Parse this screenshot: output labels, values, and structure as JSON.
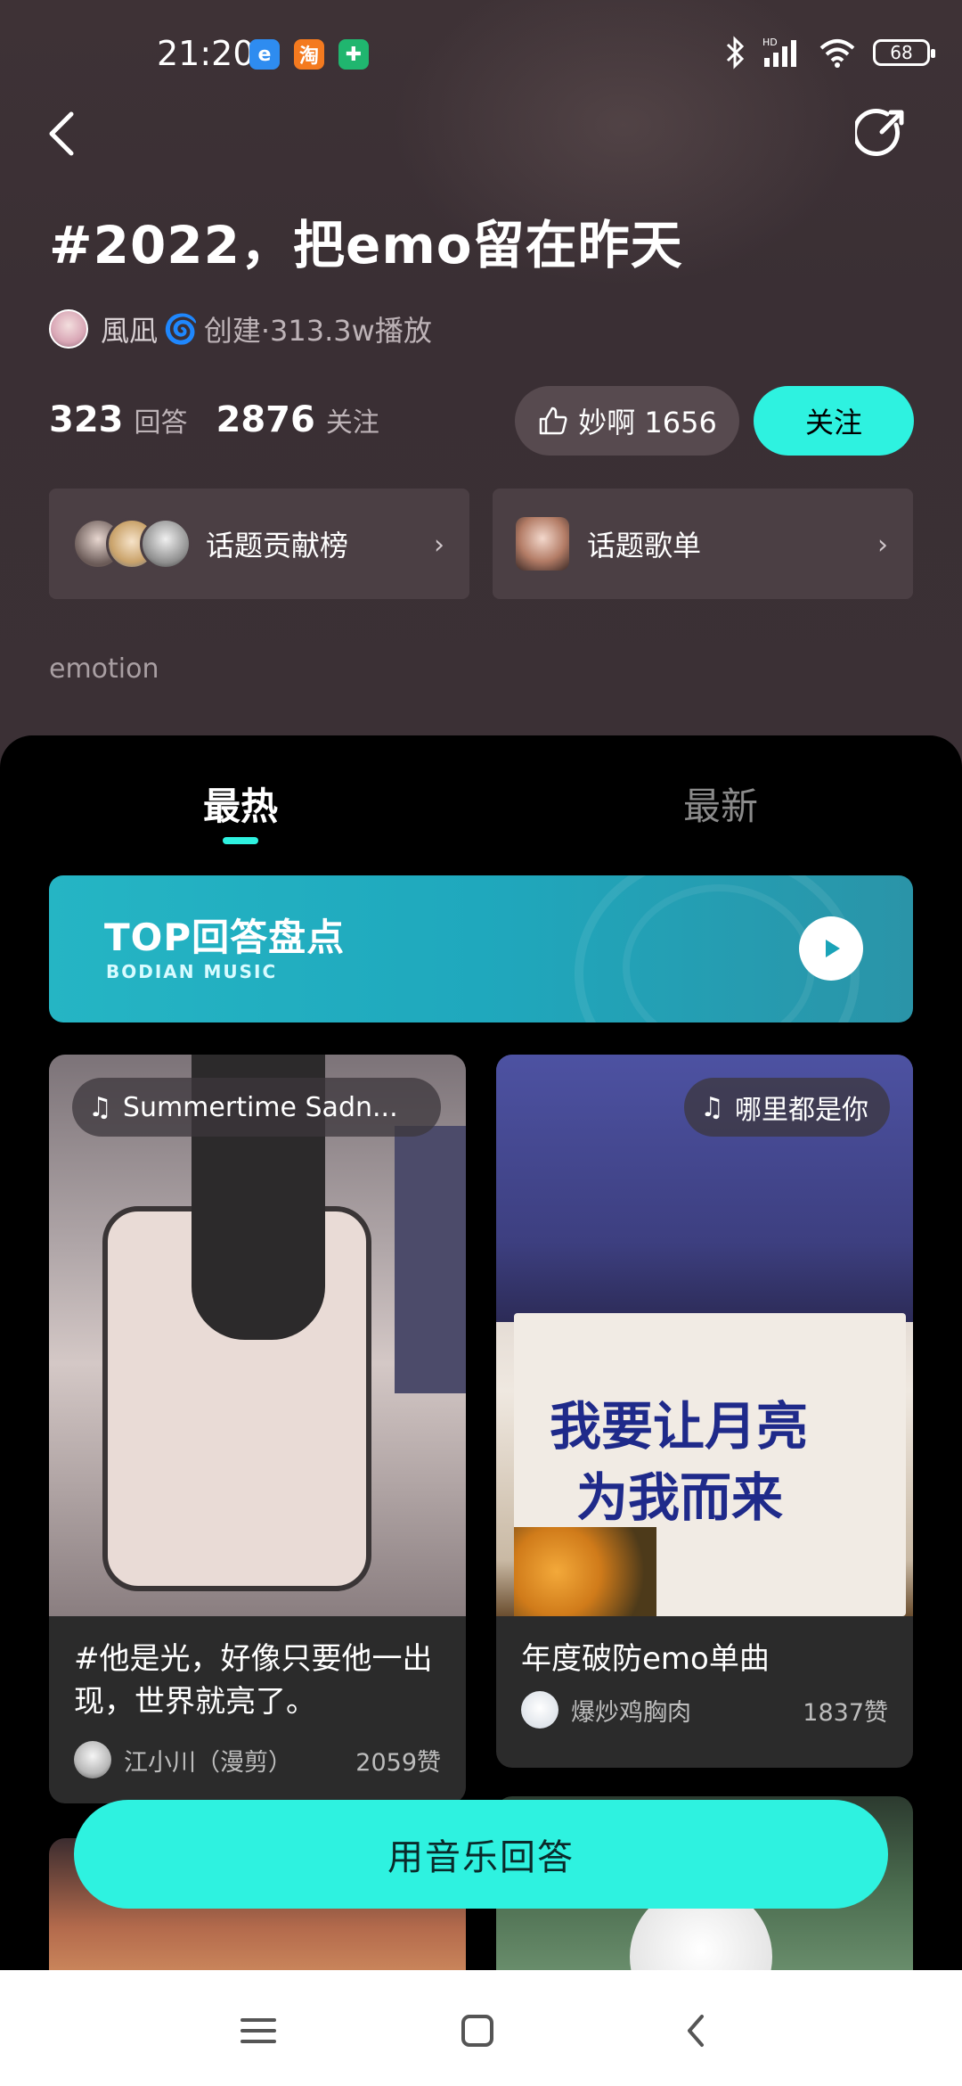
{
  "status_bar": {
    "time": "21:20",
    "app_icons": [
      "e-icon",
      "淘",
      "shield-icon"
    ],
    "battery": "68",
    "network": "HD"
  },
  "topic": {
    "title": "#2022，把emo留在昨天",
    "creator": "風凪",
    "creator_suffix": "创建·313.3w播放",
    "answers_count": "323",
    "answers_label": "回答",
    "followers_count": "2876",
    "followers_label": "关注",
    "miao_label": "妙啊 1656",
    "follow_button": "关注",
    "tag": "emotion"
  },
  "cards": {
    "contrib_label": "话题贡献榜",
    "playlist_label": "话题歌单"
  },
  "tabs": {
    "hot": "最热",
    "new": "最新"
  },
  "banner": {
    "title": "TOP回答盘点",
    "subtitle": "BODIAN MUSIC"
  },
  "posts": [
    {
      "song": "Summertime Sadn...",
      "desc": "#他是光，好像只要他一出现，世界就亮了。",
      "author": "江小川（漫剪）",
      "likes": "2059赞"
    },
    {
      "song": "哪里都是你",
      "image_text_1": "我要让月亮",
      "image_text_2": "为我而来",
      "desc": "年度破防emo单曲",
      "author": "爆炒鸡胸肉",
      "likes": "1837赞"
    }
  ],
  "answer_button": "用音乐回答",
  "colors": {
    "accent": "#2ef2e0",
    "header_bg": "#3b3035"
  }
}
